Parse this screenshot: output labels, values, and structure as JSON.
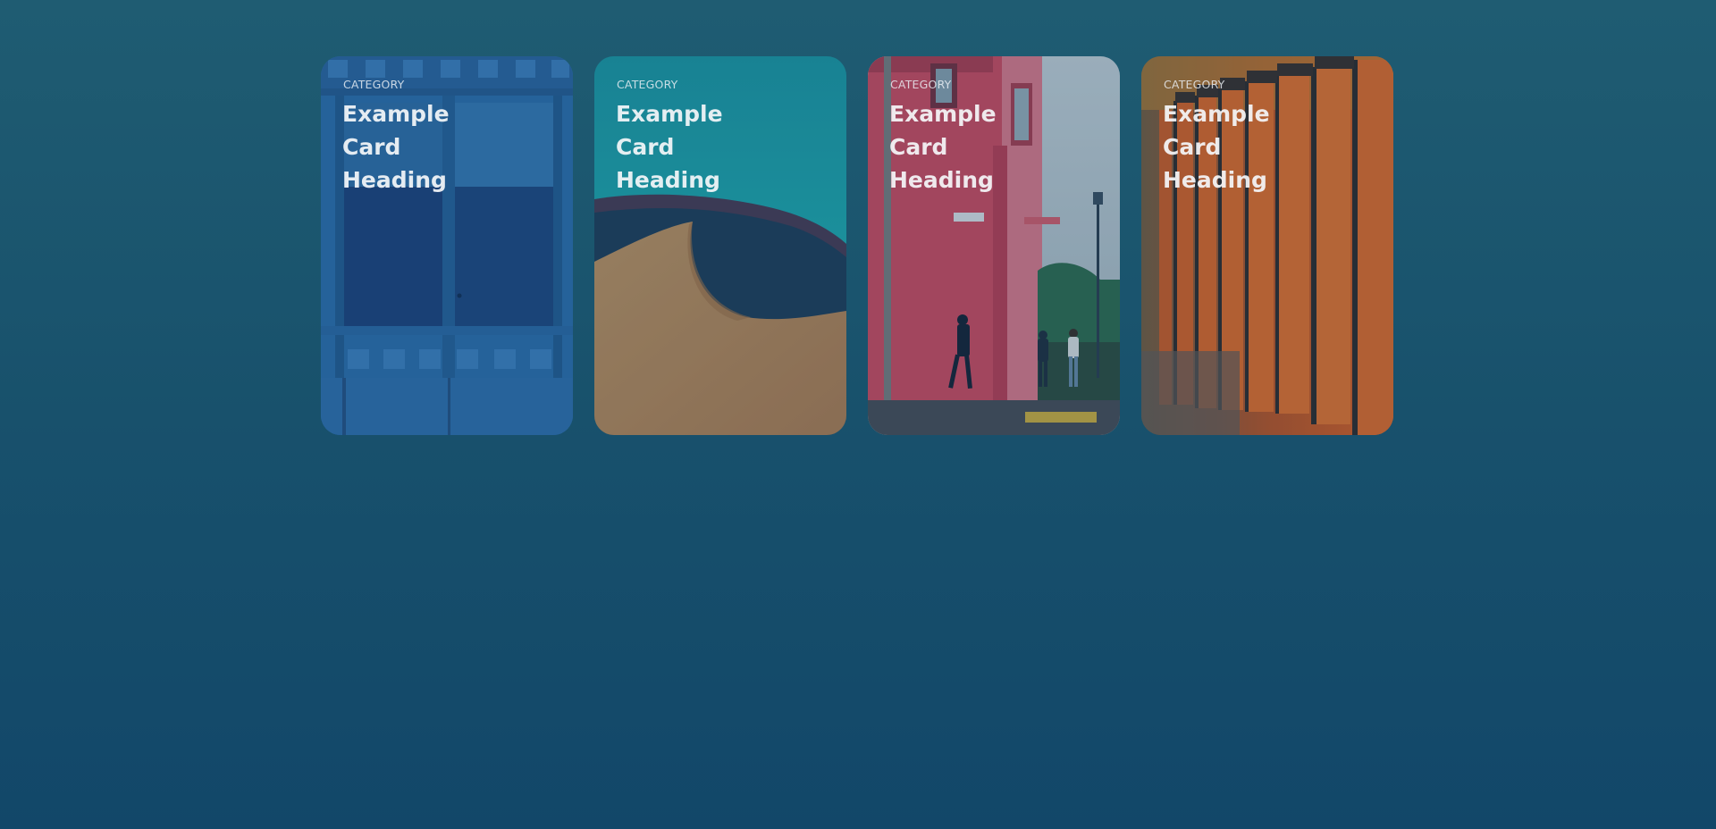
{
  "cards": [
    {
      "category": "CATEGORY",
      "heading": "Example Card Heading",
      "image": "blue-doors-photo"
    },
    {
      "category": "CATEGORY",
      "heading": "Example Card Heading",
      "image": "sand-dune-photo"
    },
    {
      "category": "CATEGORY",
      "heading": "Example Card Heading",
      "image": "pink-building-street-photo"
    },
    {
      "category": "CATEGORY",
      "heading": "Example Card Heading",
      "image": "orange-torii-gates-photo"
    }
  ]
}
